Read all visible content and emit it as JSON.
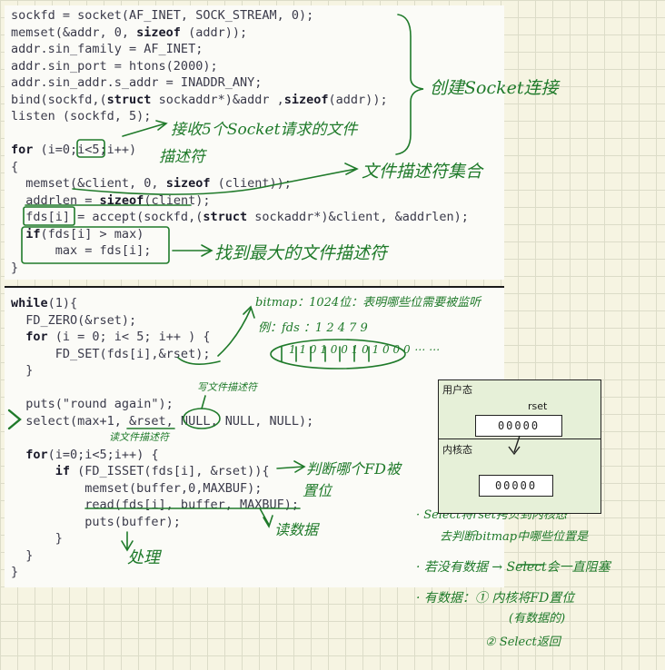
{
  "code_block_1": {
    "lines": [
      "sockfd = socket(AF_INET, SOCK_STREAM, 0);",
      "memset(&addr, 0, sizeof (addr));",
      "addr.sin_family = AF_INET;",
      "addr.sin_port = htons(2000);",
      "addr.sin_addr.s_addr = INADDR_ANY;",
      "bind(sockfd,(struct sockaddr*)&addr ,sizeof(addr));",
      "listen (sockfd, 5);",
      "",
      "for (i=0;i<5;i++)",
      "{",
      "  memset(&client, 0, sizeof (client));",
      "  addrlen = sizeof(client);",
      "  fds[i] = accept(sockfd,(struct sockaddr*)&client, &addrlen);",
      "  if(fds[i] > max)",
      "      max = fds[i];",
      "}"
    ]
  },
  "code_block_2": {
    "lines": [
      "while(1){",
      "  FD_ZERO(&rset);",
      "  for (i = 0; i< 5; i++ ) {",
      "      FD_SET(fds[i],&rset);",
      "  }",
      "",
      "  puts(\"round again\");",
      "  select(max+1, &rset, NULL, NULL, NULL);",
      "",
      "  for(i=0;i<5;i++) {",
      "      if (FD_ISSET(fds[i], &rset)){",
      "          memset(buffer,0,MAXBUF);",
      "          read(fds[i], buffer, MAXBUF);",
      "          puts(buffer);",
      "      }",
      "  }",
      "}"
    ]
  },
  "annotations": {
    "create_socket": "创建Socket连接",
    "accept_five": "接收5个Socket请求的文件",
    "descriptor": "描述符",
    "fd_set": "文件描述符集合",
    "find_max": "找到最大的文件描述符",
    "bitmap": "bitmap：1024位：表明哪些位需要被监听",
    "example_fds": "例：fds  ：1 2 4 7 9",
    "bitmap_bits": "1 1 0 1 0 0 1 0 1   0 0 0 ⋯ ⋯",
    "write_fd": "写文件描述符",
    "read_fd": "读文件描述符",
    "check_fd": "判断哪个FD被",
    "set_position": "置位",
    "read_data": "读数据",
    "process": "处理",
    "select_copy": "· Select将rset拷贝到内核态",
    "kernel_check": "去判断bitmap中哪些位置是",
    "no_data": "· 若没有数据 → Select会一直阻塞",
    "has_data": "· 有数据：① 内核将FD置位",
    "has_data_note": "(有数据的)",
    "select_return": "② Select返回"
  },
  "diagram": {
    "user_space": "用户态",
    "kernel_space": "内核态",
    "rset": "rset",
    "user_bits": "00000",
    "kernel_bits": "00000"
  }
}
